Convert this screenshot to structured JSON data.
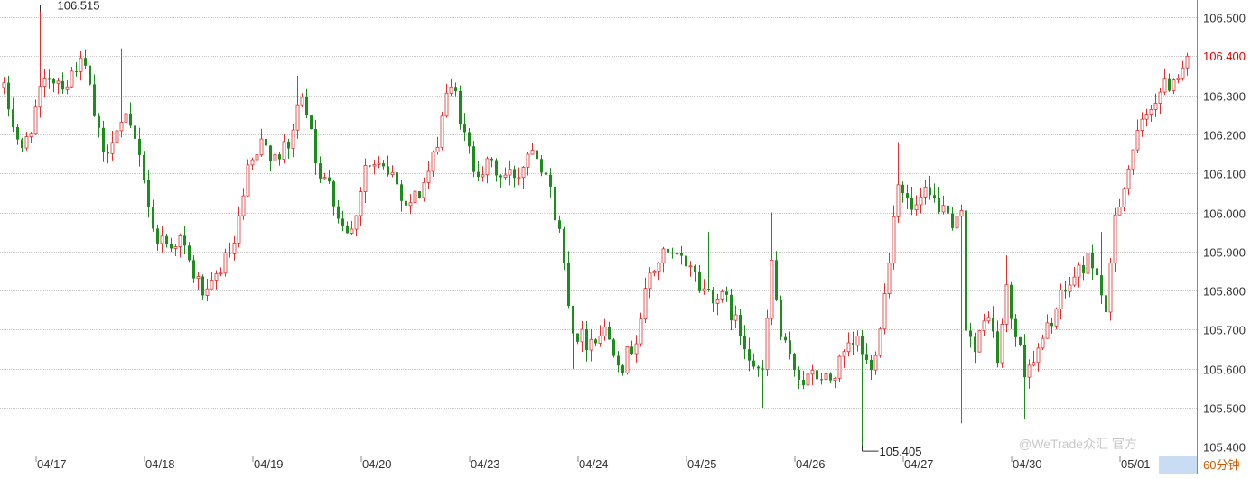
{
  "chart_data": {
    "type": "candlestick",
    "timeframe": "60分钟",
    "watermark": "@WeTrade众汇 官方",
    "current_price": "106.400",
    "y_axis": {
      "ticks": [
        "106.500",
        "106.400",
        "106.300",
        "106.200",
        "106.100",
        "106.000",
        "105.900",
        "105.800",
        "105.700",
        "105.600",
        "105.500",
        "105.400"
      ],
      "range": [
        105.38,
        106.545
      ]
    },
    "x_axis": {
      "labels": [
        "04/17",
        "04/18",
        "04/19",
        "04/20",
        "04/23",
        "04/24",
        "04/25",
        "04/26",
        "04/27",
        "04/30",
        "05/01"
      ],
      "candle_index": [
        0,
        24,
        48,
        72,
        96,
        120,
        144,
        168,
        192,
        216,
        240
      ]
    },
    "annotations": [
      {
        "label": "106.515",
        "type": "high",
        "candle_index": 8
      },
      {
        "label": "105.405",
        "type": "low",
        "candle_index": 190
      }
    ],
    "colors": {
      "up": "#e03030",
      "down": "#1c8c1c",
      "grid": "#c8c8c8",
      "axis_text": "#333333",
      "price_text": "#e00000",
      "timeframe_text": "#d05a00",
      "axis_highlight": "#c8dcf4"
    },
    "anchors": [
      [
        0,
        106.31
      ],
      [
        4,
        106.15
      ],
      [
        8,
        106.3
      ],
      [
        10,
        106.35
      ],
      [
        14,
        106.33
      ],
      [
        16,
        106.38
      ],
      [
        18,
        106.37
      ],
      [
        20,
        106.25
      ],
      [
        22,
        106.14
      ],
      [
        24,
        106.2
      ],
      [
        27,
        106.23
      ],
      [
        30,
        106.16
      ],
      [
        33,
        105.95
      ],
      [
        36,
        105.92
      ],
      [
        39,
        105.93
      ],
      [
        42,
        105.84
      ],
      [
        45,
        105.78
      ],
      [
        48,
        105.86
      ],
      [
        51,
        105.91
      ],
      [
        54,
        106.1
      ],
      [
        57,
        106.17
      ],
      [
        60,
        106.15
      ],
      [
        63,
        106.16
      ],
      [
        66,
        106.31
      ],
      [
        68,
        106.22
      ],
      [
        70,
        106.07
      ],
      [
        72,
        106.09
      ],
      [
        74,
        105.99
      ],
      [
        77,
        105.95
      ],
      [
        80,
        106.12
      ],
      [
        83,
        106.11
      ],
      [
        86,
        106.1
      ],
      [
        89,
        106.02
      ],
      [
        92,
        106.05
      ],
      [
        95,
        106.13
      ],
      [
        98,
        106.31
      ],
      [
        100,
        106.3
      ],
      [
        102,
        106.19
      ],
      [
        104,
        106.12
      ],
      [
        106,
        106.11
      ],
      [
        108,
        106.12
      ],
      [
        110,
        106.09
      ],
      [
        114,
        106.1
      ],
      [
        117,
        106.18
      ],
      [
        120,
        106.1
      ],
      [
        123,
        105.95
      ],
      [
        126,
        105.7
      ],
      [
        129,
        105.67
      ],
      [
        133,
        105.7
      ],
      [
        137,
        105.61
      ],
      [
        140,
        105.68
      ],
      [
        143,
        105.84
      ],
      [
        146,
        105.89
      ],
      [
        149,
        105.88
      ],
      [
        152,
        105.87
      ],
      [
        154,
        105.81
      ],
      [
        157,
        105.79
      ],
      [
        160,
        105.77
      ],
      [
        163,
        105.69
      ],
      [
        166,
        105.62
      ],
      [
        168,
        105.58
      ],
      [
        170,
        105.87
      ],
      [
        172,
        105.68
      ],
      [
        174,
        105.62
      ],
      [
        177,
        105.57
      ],
      [
        180,
        105.58
      ],
      [
        183,
        105.57
      ],
      [
        186,
        105.63
      ],
      [
        189,
        105.67
      ],
      [
        192,
        105.59
      ],
      [
        195,
        105.79
      ],
      [
        198,
        106.09
      ],
      [
        201,
        106.0
      ],
      [
        204,
        106.04
      ],
      [
        207,
        106.02
      ],
      [
        210,
        105.95
      ],
      [
        212,
        105.99
      ],
      [
        213,
        105.72
      ],
      [
        215,
        105.64
      ],
      [
        218,
        105.75
      ],
      [
        220,
        105.62
      ],
      [
        222,
        105.8
      ],
      [
        223,
        105.73
      ],
      [
        226,
        105.6
      ],
      [
        229,
        105.64
      ],
      [
        232,
        105.73
      ],
      [
        235,
        105.8
      ],
      [
        238,
        105.85
      ],
      [
        240,
        105.88
      ],
      [
        242,
        105.85
      ],
      [
        244,
        105.72
      ],
      [
        246,
        106.0
      ],
      [
        248,
        106.07
      ],
      [
        250,
        106.16
      ],
      [
        252,
        106.22
      ],
      [
        254,
        106.28
      ],
      [
        256,
        106.31
      ],
      [
        258,
        106.33
      ],
      [
        260,
        106.36
      ],
      [
        262,
        106.4
      ]
    ],
    "spikes": [
      [
        8,
        106.515,
        "h"
      ],
      [
        26,
        106.42,
        "h"
      ],
      [
        65,
        106.35,
        "h"
      ],
      [
        126,
        105.6,
        "l"
      ],
      [
        156,
        105.95,
        "h"
      ],
      [
        168,
        105.5,
        "l"
      ],
      [
        170,
        106.0,
        "h"
      ],
      [
        190,
        105.405,
        "l"
      ],
      [
        198,
        106.18,
        "h"
      ],
      [
        212,
        105.46,
        "l"
      ],
      [
        222,
        105.89,
        "h"
      ],
      [
        226,
        105.47,
        "l"
      ],
      [
        243,
        105.95,
        "h"
      ]
    ]
  }
}
